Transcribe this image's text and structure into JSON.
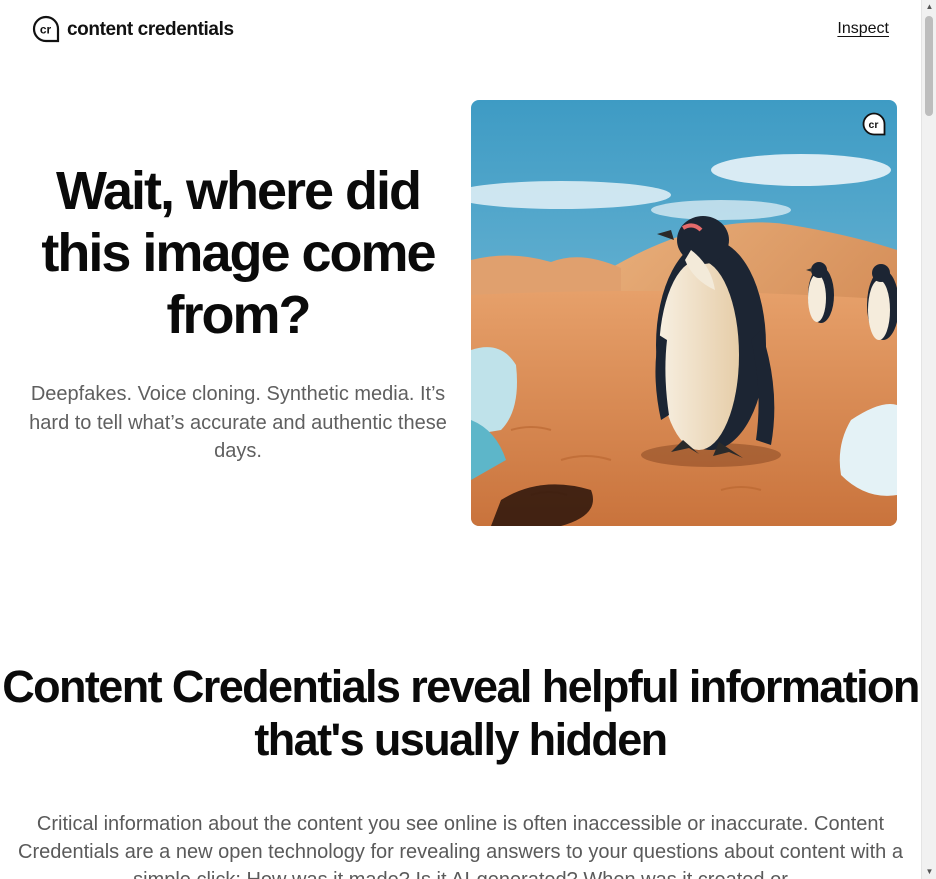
{
  "header": {
    "logo_text": "content credentials",
    "logo_icon": "cr-logo-icon",
    "nav_inspect": "Inspect"
  },
  "hero": {
    "title": "Wait, where did this image come from?",
    "subtitle": "Deepfakes. Voice cloning. Synthetic media. It’s hard to tell what’s accurate and authentic these days.",
    "image_badge": "cr-badge-icon"
  },
  "section2": {
    "title": "Content Credentials reveal helpful information that's usually hidden",
    "body": "Critical information about the content you see online is often inaccessible or inaccurate. Content Credentials are a new open technology for revealing answers to your questions about content with a simple click: How was it made? Is it AI-generated? When was it created or"
  },
  "colors": {
    "text_dark": "#0a0a0a",
    "text_muted": "#5f5f5f",
    "sky": "#4fa7cc",
    "sand": "#d98a52"
  }
}
